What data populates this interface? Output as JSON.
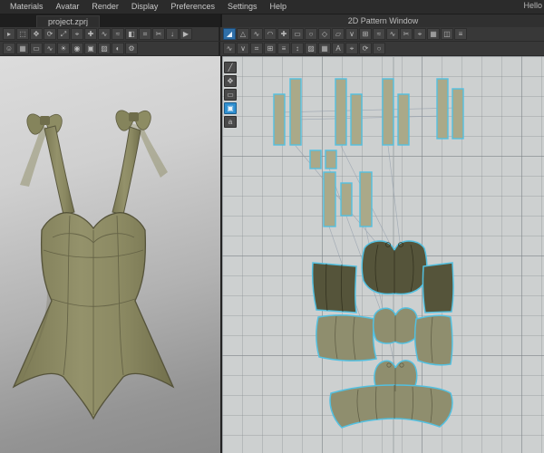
{
  "menubar": {
    "items": [
      {
        "id": "menu-materials",
        "label": "Materials"
      },
      {
        "id": "menu-avatar",
        "label": "Avatar"
      },
      {
        "id": "menu-render",
        "label": "Render"
      },
      {
        "id": "menu-display",
        "label": "Display"
      },
      {
        "id": "menu-preferences",
        "label": "Preferences"
      },
      {
        "id": "menu-settings",
        "label": "Settings"
      },
      {
        "id": "menu-help",
        "label": "Help"
      }
    ],
    "greeting": "Hello"
  },
  "tabbar": {
    "project_tab": "project.zprj",
    "pattern_window_title": "2D Pattern Window"
  },
  "toolbars": {
    "left_row1": [
      {
        "n": "select-tool-icon",
        "g": "▸"
      },
      {
        "n": "box-select-icon",
        "g": "⬚"
      },
      {
        "n": "move-gizmo-icon",
        "g": "✥"
      },
      {
        "n": "rotate-gizmo-icon",
        "g": "⟳"
      },
      {
        "n": "scale-gizmo-icon",
        "g": "⤢"
      },
      {
        "n": "pin-tool-icon",
        "g": "⌖"
      },
      {
        "n": "tack-tool-icon",
        "g": "✚"
      },
      {
        "n": "sewing-tool-icon",
        "g": "∿"
      },
      {
        "n": "seam-tool-icon",
        "g": "≈"
      },
      {
        "n": "fold-tool-icon",
        "g": "◧"
      },
      {
        "n": "measure-tool-icon",
        "g": "⌗"
      },
      {
        "n": "scissors-tool-icon",
        "g": "✂"
      },
      {
        "n": "gravity-tool-icon",
        "g": "↓"
      },
      {
        "n": "simulate-button-icon",
        "g": "▶"
      }
    ],
    "left_row2": [
      {
        "n": "avatar-display-icon",
        "g": "☺"
      },
      {
        "n": "arrangement-icon",
        "g": "▦"
      },
      {
        "n": "tape-tool-icon",
        "g": "▭"
      },
      {
        "n": "wind-tool-icon",
        "g": "∿"
      },
      {
        "n": "light-settings-icon",
        "g": "☀"
      },
      {
        "n": "camera-icon",
        "g": "◉"
      },
      {
        "n": "snapshot-icon",
        "g": "▣"
      },
      {
        "n": "texture-display-icon",
        "g": "▨"
      },
      {
        "n": "color-display-icon",
        "g": "◐"
      },
      {
        "n": "settings-gear-icon",
        "g": "⚙"
      }
    ],
    "right_row1": [
      {
        "n": "transform-pattern-icon",
        "g": "◢",
        "active": true
      },
      {
        "n": "edit-pattern-icon",
        "g": "△"
      },
      {
        "n": "edit-curve-icon",
        "g": "∿"
      },
      {
        "n": "edit-curvature-icon",
        "g": "◠"
      },
      {
        "n": "add-point-icon",
        "g": "✚"
      },
      {
        "n": "rectangle-pattern-icon",
        "g": "▭"
      },
      {
        "n": "circle-pattern-icon",
        "g": "○"
      },
      {
        "n": "dart-tool-icon",
        "g": "◇"
      },
      {
        "n": "polygon-tool-icon",
        "g": "▱"
      },
      {
        "n": "notch-tool-icon",
        "g": "∨"
      },
      {
        "n": "internal-rect-icon",
        "g": "⊞"
      },
      {
        "n": "segment-sewing-icon",
        "g": "≈"
      },
      {
        "n": "free-sewing-icon",
        "g": "∿"
      },
      {
        "n": "cut-sew-icon",
        "g": "✂"
      },
      {
        "n": "grading-icon",
        "g": "⌖"
      },
      {
        "n": "pattern-grid-icon",
        "g": "▦"
      },
      {
        "n": "symmetric-pattern-icon",
        "g": "◫"
      },
      {
        "n": "layer-icon",
        "g": "≡"
      }
    ],
    "right_row2": [
      {
        "n": "show-sewing-lines-icon",
        "g": "∿"
      },
      {
        "n": "show-notches-icon",
        "g": "∨"
      },
      {
        "n": "show-grid-icon",
        "g": "⌗"
      },
      {
        "n": "snap-grid-icon",
        "g": "⊞"
      },
      {
        "n": "show-baseline-icon",
        "g": "≡"
      },
      {
        "n": "grain-line-icon",
        "g": "↕"
      },
      {
        "n": "texture-surface-icon",
        "g": "▨"
      },
      {
        "n": "mesh-surface-icon",
        "g": "▦"
      },
      {
        "n": "show-pattern-name-icon",
        "g": "A"
      },
      {
        "n": "show-measure-icon",
        "g": "⌖"
      },
      {
        "n": "sync-3d-icon",
        "g": "⟳"
      },
      {
        "n": "reset-2d-view-icon",
        "g": "○"
      }
    ],
    "side_tools": [
      {
        "n": "pen-tool-icon",
        "g": "╱"
      },
      {
        "n": "pan-tool-icon",
        "g": "✥"
      },
      {
        "n": "view-box-icon",
        "g": "▭"
      },
      {
        "n": "texture-paint-icon",
        "g": "▣",
        "active": true
      },
      {
        "n": "text-annotate-icon",
        "g": "a"
      }
    ]
  },
  "colors": {
    "accent_blue": "#2f8fd0",
    "selection_cyan": "#53c0e0",
    "garment_olive": "#8d8c63",
    "garment_olive_dark": "#716f4d",
    "pattern_dark_olive": "#55543a",
    "pattern_light_olive": "#8f8e6e",
    "grid_bg": "#cdd0d0"
  }
}
